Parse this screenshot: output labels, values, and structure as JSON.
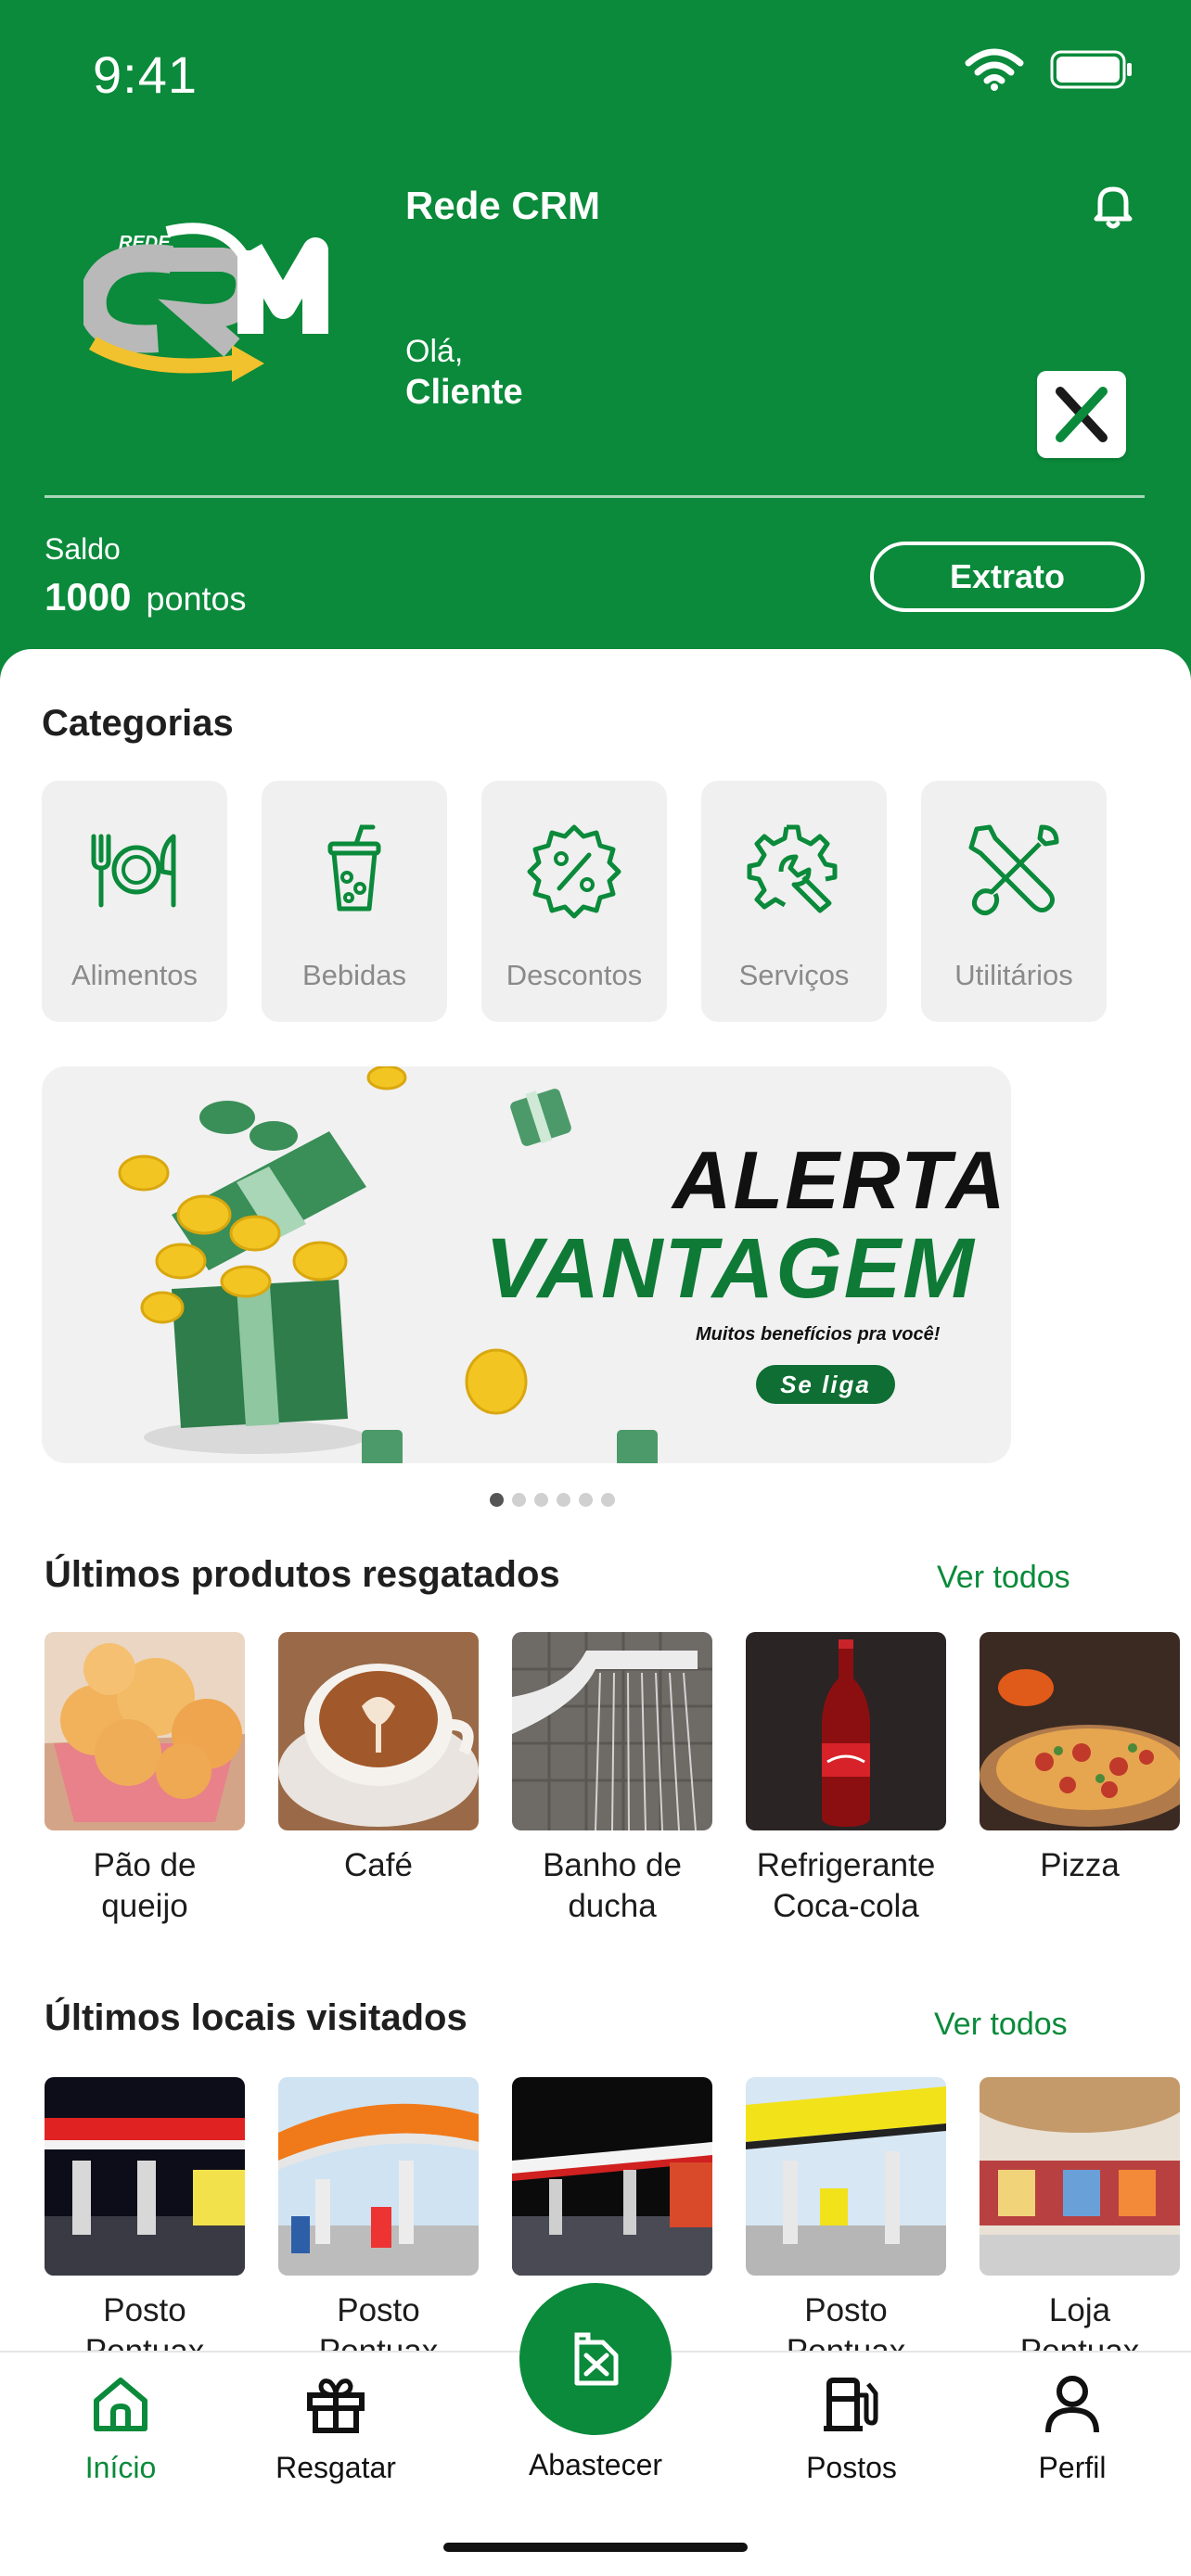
{
  "status_bar": {
    "time": "9:41"
  },
  "header": {
    "logo_text_small": "REDE",
    "logo_text_big": "CRM",
    "app_name": "Rede CRM",
    "greeting": "Olá,",
    "user_name": "Cliente",
    "balance_label": "Saldo",
    "balance_value": "1000",
    "balance_unit": "pontos",
    "statement_button": "Extrato",
    "badge_letter": "X"
  },
  "categories": {
    "title": "Categorias",
    "items": [
      {
        "label": "Alimentos",
        "icon": "plate-cutlery-icon"
      },
      {
        "label": "Bebidas",
        "icon": "cup-icon"
      },
      {
        "label": "Descontos",
        "icon": "discount-badge-icon"
      },
      {
        "label": "Serviços",
        "icon": "gear-wrench-icon"
      },
      {
        "label": "Utilitários",
        "icon": "tools-icon"
      }
    ]
  },
  "banner": {
    "title_line1": "ALERTA",
    "title_line2": "VANTAGEM",
    "subtitle": "Muitos benefícios pra você!",
    "cta": "Se liga",
    "slides_total": 6,
    "slide_active": 1
  },
  "products": {
    "title": "Últimos produtos resgatados",
    "see_all": "Ver todos",
    "items": [
      {
        "line1": "Pão de",
        "line2": "queijo"
      },
      {
        "line1": "Café",
        "line2": ""
      },
      {
        "line1": "Banho de",
        "line2": "ducha"
      },
      {
        "line1": "Refrigerante",
        "line2": "Coca-cola"
      },
      {
        "line1": "Pizza",
        "line2": ""
      }
    ]
  },
  "places": {
    "title": "Últimos locais visitados",
    "see_all": "Ver todos",
    "items": [
      {
        "line1": "Posto",
        "line2": "Pontuax"
      },
      {
        "line1": "Posto",
        "line2": "Pontuax"
      },
      {
        "line1": "",
        "line2": ""
      },
      {
        "line1": "Posto",
        "line2": "Pontuax"
      },
      {
        "line1": "Loja",
        "line2": "Pontuax"
      }
    ]
  },
  "tabbar": {
    "home": "Início",
    "redeem": "Resgatar",
    "fuel": "Abastecer",
    "stations": "Postos",
    "profile": "Perfil",
    "active": "home"
  },
  "colors": {
    "brand_green": "#0a8a3a",
    "card_bg": "#f0f0f0"
  }
}
